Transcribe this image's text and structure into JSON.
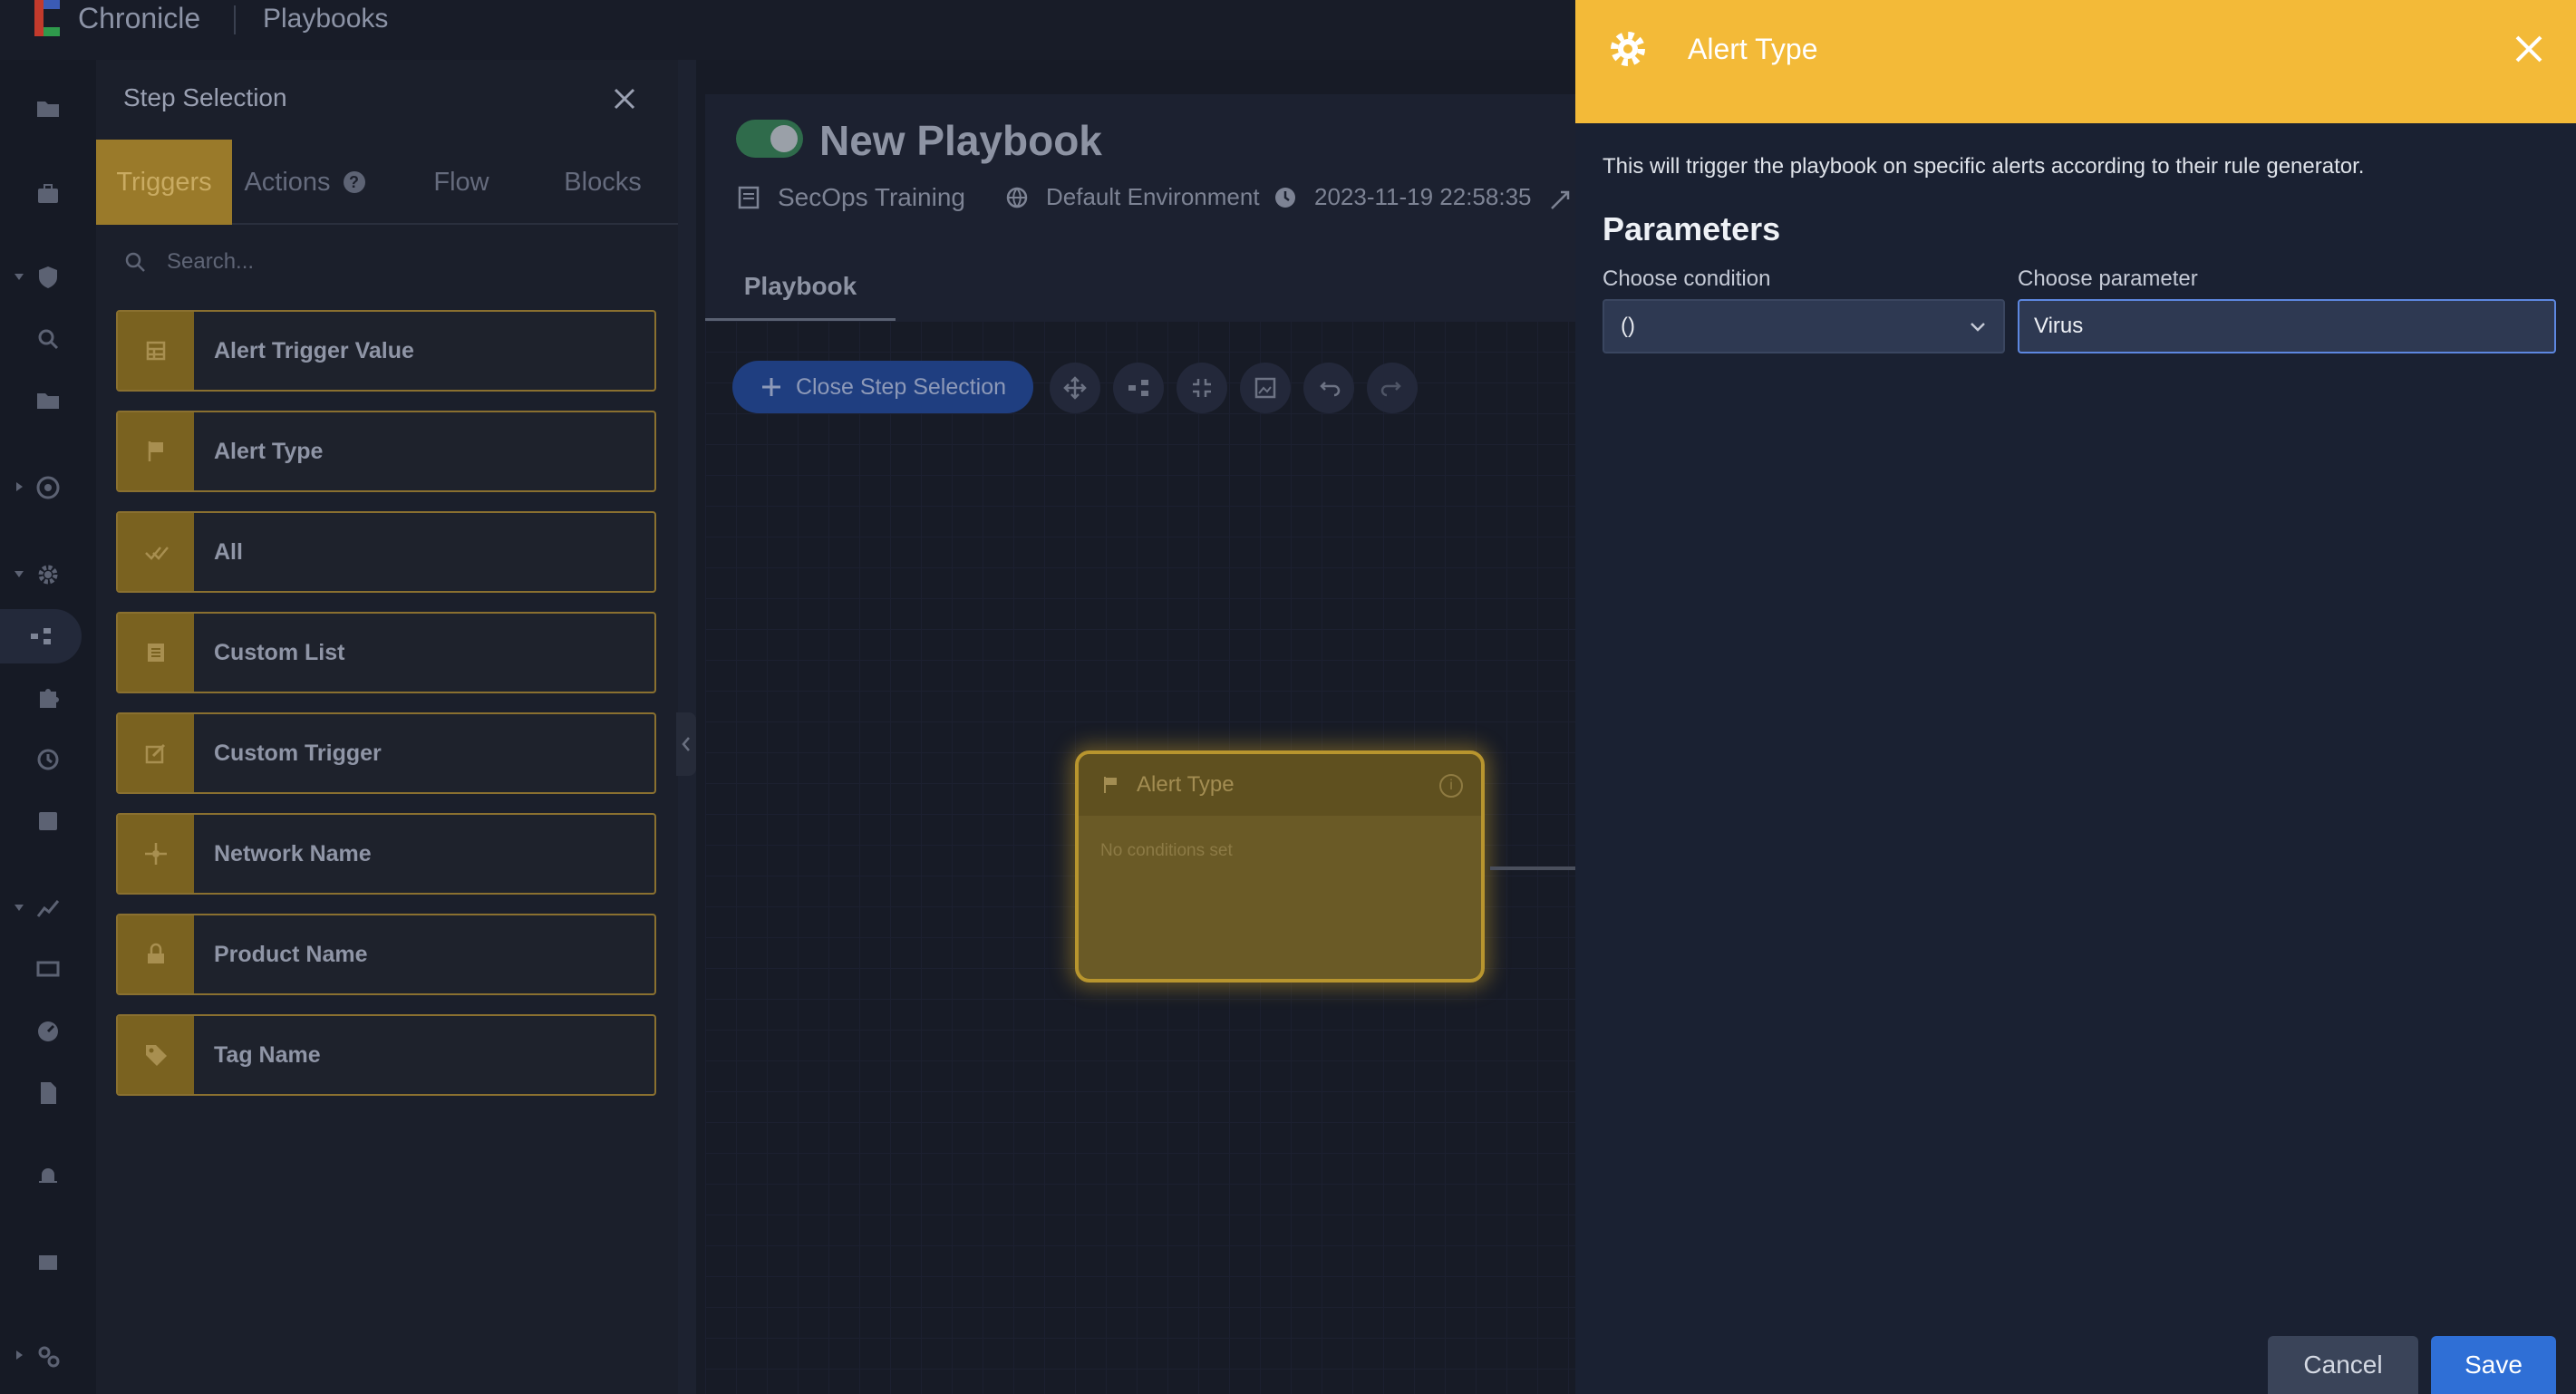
{
  "app": {
    "brand": "Chronicle",
    "breadcrumb": "Playbooks"
  },
  "step_selection": {
    "title": "Step Selection",
    "tabs": [
      {
        "label": "Triggers",
        "active": true
      },
      {
        "label": "Actions",
        "active": false,
        "help_icon": "help-icon"
      },
      {
        "label": "Flow",
        "active": false
      },
      {
        "label": "Blocks",
        "active": false
      }
    ],
    "search_placeholder": "Search...",
    "triggers": [
      {
        "label": "Alert Trigger Value",
        "icon": "table-icon"
      },
      {
        "label": "Alert Type",
        "icon": "flag-icon"
      },
      {
        "label": "All",
        "icon": "checks-icon"
      },
      {
        "label": "Custom List",
        "icon": "list-icon"
      },
      {
        "label": "Custom Trigger",
        "icon": "edit-icon"
      },
      {
        "label": "Network Name",
        "icon": "network-icon"
      },
      {
        "label": "Product Name",
        "icon": "product-icon"
      },
      {
        "label": "Tag Name",
        "icon": "tag-icon"
      }
    ]
  },
  "playbook": {
    "title": "New Playbook",
    "enabled": true,
    "folder": "SecOps Training",
    "environment": "Default Environment",
    "timestamp": "2023-11-19 22:58:35",
    "tab": "Playbook",
    "close_step_label": "Close Step Selection",
    "node": {
      "title": "Alert Type",
      "body": "No conditions set"
    }
  },
  "drawer": {
    "title": "Alert Type",
    "description": "This will trigger the playbook on specific alerts according to their rule generator.",
    "section": "Parameters",
    "condition_label": "Choose condition",
    "condition_value": "()",
    "parameter_label": "Choose parameter",
    "parameter_value": "Virus",
    "cancel_label": "Cancel",
    "save_label": "Save"
  },
  "colors": {
    "accent": "#f3ba38",
    "primary": "#2f6fd6",
    "trigger_gold": "#7a6220"
  }
}
